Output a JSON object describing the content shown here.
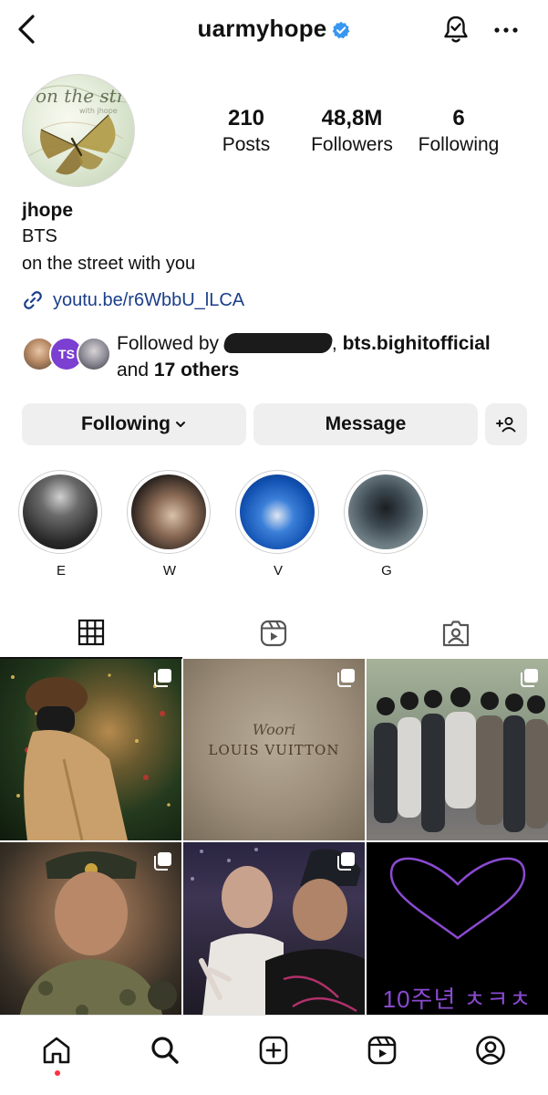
{
  "header": {
    "username": "uarmyhope"
  },
  "stats": [
    {
      "value": "210",
      "label": "Posts"
    },
    {
      "value": "48,8M",
      "label": "Followers"
    },
    {
      "value": "6",
      "label": "Following"
    }
  ],
  "bio": {
    "name": "jhope",
    "line1": "BTS",
    "line2": "on the street with you",
    "link": "youtu.be/r6WbbU_lLCA"
  },
  "followed_by": {
    "prefix": "Followed by",
    "account2": "bts.bighitofficial",
    "and": "and",
    "others": "17 others",
    "avatar_mid_text": "TS"
  },
  "buttons": {
    "following": "Following",
    "message": "Message"
  },
  "highlights": [
    {
      "label": "E"
    },
    {
      "label": "W"
    },
    {
      "label": "V"
    },
    {
      "label": "G"
    }
  ],
  "posts": {
    "lv_text_top": "Woori",
    "lv_text_bottom": "LOUIS VUITTON",
    "heart_caption": "10주년 ㅊㅋㅊ"
  },
  "colors": {
    "verified": "#3897f0",
    "link": "#1a3e8a",
    "notification_dot": "#ff3040",
    "button_bg": "#efefef"
  },
  "icons": [
    "back-icon",
    "verified-icon",
    "bell-icon",
    "more-icon",
    "link-icon",
    "chevron-down-icon",
    "add-person-icon",
    "grid-icon",
    "reels-icon",
    "tagged-icon",
    "home-icon",
    "search-icon",
    "create-icon",
    "reels-nav-icon",
    "profile-icon",
    "multi-post-icon"
  ]
}
